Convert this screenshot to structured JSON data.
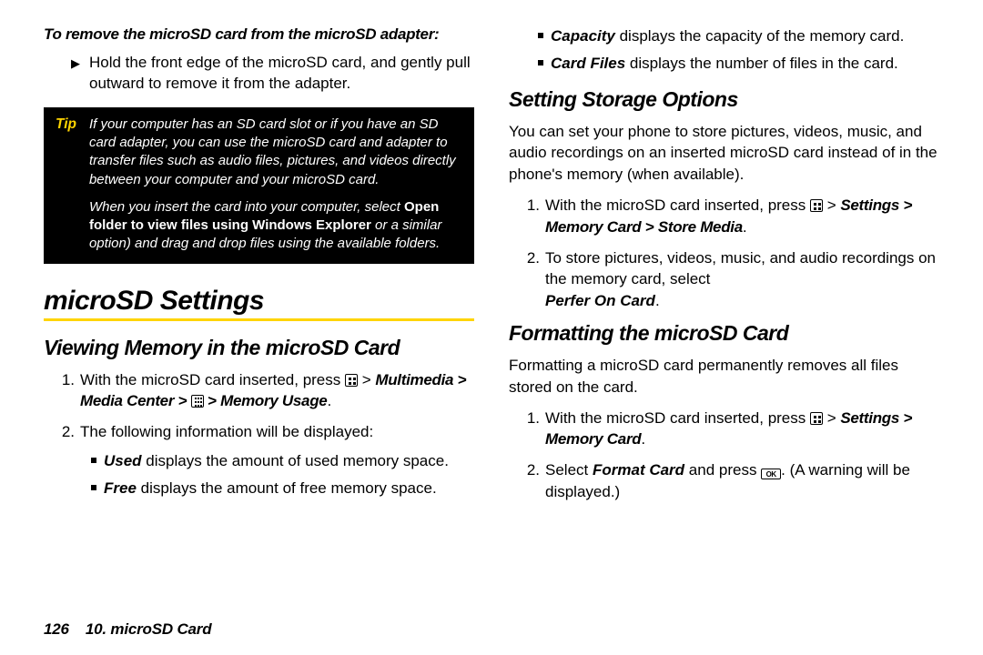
{
  "left": {
    "lead": "To remove the microSD card from the microSD adapter:",
    "remove_step": "Hold the front edge of the microSD card, and gently pull outward to remove it from the adapter.",
    "tip": {
      "label": "Tip",
      "p1": "If your computer has an SD card slot or if you have an SD card adapter, you can use the microSD card and adapter to transfer files such as audio files, pictures, and videos directly between your computer and your microSD card.",
      "p2_a": "When you insert the card into your computer, select ",
      "p2_bold": "Open folder to view files using Windows Explorer",
      "p2_b": " or a similar option) and drag and drop files using the available folders."
    },
    "h1": "microSD Settings",
    "h2_view": "Viewing Memory in the microSD Card",
    "view_step1_a": "With the microSD card inserted, press ",
    "view_step1_gt": " > ",
    "view_step1_path_a": "Multimedia > Media Center > ",
    "view_step1_path_b": " > Memory Usage",
    "view_step2": "The following information will be displayed:",
    "view_used_b": "Used",
    "view_used": " displays the amount of used memory space.",
    "view_free_b": "Free",
    "view_free": " displays the amount of free memory space."
  },
  "right": {
    "cap_b": "Capacity",
    "cap": " displays the capacity of the memory card.",
    "cf_b": "Card Files",
    "cf": " displays the number of files in the card.",
    "h2_storage": "Setting Storage Options",
    "storage_intro": "You can set your phone to store pictures, videos, music, and audio recordings on an inserted microSD card instead of in the phone's memory (when available).",
    "st1_a": "With the microSD card inserted, press ",
    "st1_gt": " > ",
    "st1_path": "Settings > Memory Card > Store Media",
    "st1_dot": ".",
    "st2_a": "To store pictures, videos, music, and audio recordings on the memory card, select ",
    "st2_b": "Perfer On Card",
    "st2_dot": ".",
    "h2_format": "Formatting the microSD Card",
    "format_intro": "Formatting a microSD card permanently removes all files stored on the card.",
    "fm1_a": "With the microSD card inserted, press ",
    "fm1_gt": " > ",
    "fm1_b": "Settings > Memory Card",
    "fm1_dot": ".",
    "fm2_a": "Select ",
    "fm2_b": "Format Card",
    "fm2_c": " and press ",
    "fm2_d": ". (A warning will be displayed.)"
  },
  "footer": {
    "page": "126",
    "chapter": "10. microSD Card"
  }
}
